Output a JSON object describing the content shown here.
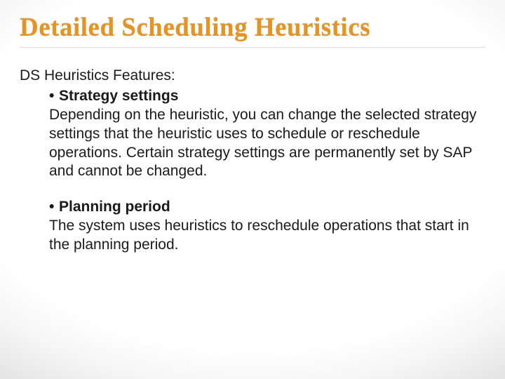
{
  "title": "Detailed Scheduling Heuristics",
  "subhead": "DS Heuristics Features:",
  "bullet": "•",
  "sections": [
    {
      "heading": "Strategy settings",
      "body": "Depending on the heuristic, you can change the selected strategy settings that the heuristic uses to schedule or reschedule operations. Certain strategy settings are permanently set by SAP and cannot be changed."
    },
    {
      "heading": "Planning period",
      "body": "The system uses heuristics to reschedule operations that start in the planning period."
    }
  ]
}
